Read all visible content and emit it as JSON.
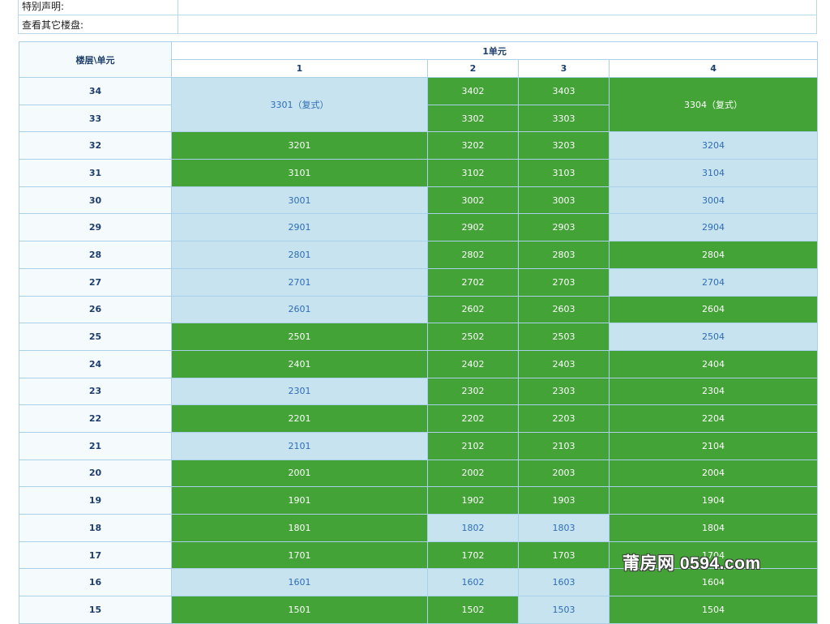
{
  "info": {
    "special_label": "特别声明:",
    "special_value": "",
    "other_label": "查看其它楼盘:",
    "other_value": ""
  },
  "table": {
    "corner_label": "楼层\\单元",
    "building_label": "1单元",
    "columns": [
      "1",
      "2",
      "3",
      "4"
    ],
    "colors": {
      "sold": "#43a336",
      "available": "#c6e3ef",
      "available_text": "#2f6db5"
    },
    "rows": [
      {
        "floor": "34",
        "cells": [
          {
            "label": "3301（复式）",
            "status": "available",
            "rowspan": 2
          },
          {
            "label": "3402",
            "status": "sold"
          },
          {
            "label": "3403",
            "status": "sold"
          },
          {
            "label": "3304（复式）",
            "status": "sold",
            "rowspan": 2
          }
        ]
      },
      {
        "floor": "33",
        "cells": [
          null,
          {
            "label": "3302",
            "status": "sold"
          },
          {
            "label": "3303",
            "status": "sold"
          },
          null
        ]
      },
      {
        "floor": "32",
        "cells": [
          {
            "label": "3201",
            "status": "sold"
          },
          {
            "label": "3202",
            "status": "sold"
          },
          {
            "label": "3203",
            "status": "sold"
          },
          {
            "label": "3204",
            "status": "available"
          }
        ]
      },
      {
        "floor": "31",
        "cells": [
          {
            "label": "3101",
            "status": "sold"
          },
          {
            "label": "3102",
            "status": "sold"
          },
          {
            "label": "3103",
            "status": "sold"
          },
          {
            "label": "3104",
            "status": "available"
          }
        ]
      },
      {
        "floor": "30",
        "cells": [
          {
            "label": "3001",
            "status": "available"
          },
          {
            "label": "3002",
            "status": "sold"
          },
          {
            "label": "3003",
            "status": "sold"
          },
          {
            "label": "3004",
            "status": "available"
          }
        ]
      },
      {
        "floor": "29",
        "cells": [
          {
            "label": "2901",
            "status": "available"
          },
          {
            "label": "2902",
            "status": "sold"
          },
          {
            "label": "2903",
            "status": "sold"
          },
          {
            "label": "2904",
            "status": "available"
          }
        ]
      },
      {
        "floor": "28",
        "cells": [
          {
            "label": "2801",
            "status": "available"
          },
          {
            "label": "2802",
            "status": "sold"
          },
          {
            "label": "2803",
            "status": "sold"
          },
          {
            "label": "2804",
            "status": "sold"
          }
        ]
      },
      {
        "floor": "27",
        "cells": [
          {
            "label": "2701",
            "status": "available"
          },
          {
            "label": "2702",
            "status": "sold"
          },
          {
            "label": "2703",
            "status": "sold"
          },
          {
            "label": "2704",
            "status": "available"
          }
        ]
      },
      {
        "floor": "26",
        "cells": [
          {
            "label": "2601",
            "status": "available"
          },
          {
            "label": "2602",
            "status": "sold"
          },
          {
            "label": "2603",
            "status": "sold"
          },
          {
            "label": "2604",
            "status": "sold"
          }
        ]
      },
      {
        "floor": "25",
        "cells": [
          {
            "label": "2501",
            "status": "sold"
          },
          {
            "label": "2502",
            "status": "sold"
          },
          {
            "label": "2503",
            "status": "sold"
          },
          {
            "label": "2504",
            "status": "available"
          }
        ]
      },
      {
        "floor": "24",
        "cells": [
          {
            "label": "2401",
            "status": "sold"
          },
          {
            "label": "2402",
            "status": "sold"
          },
          {
            "label": "2403",
            "status": "sold"
          },
          {
            "label": "2404",
            "status": "sold"
          }
        ]
      },
      {
        "floor": "23",
        "cells": [
          {
            "label": "2301",
            "status": "available"
          },
          {
            "label": "2302",
            "status": "sold"
          },
          {
            "label": "2303",
            "status": "sold"
          },
          {
            "label": "2304",
            "status": "sold"
          }
        ]
      },
      {
        "floor": "22",
        "cells": [
          {
            "label": "2201",
            "status": "sold"
          },
          {
            "label": "2202",
            "status": "sold"
          },
          {
            "label": "2203",
            "status": "sold"
          },
          {
            "label": "2204",
            "status": "sold"
          }
        ]
      },
      {
        "floor": "21",
        "cells": [
          {
            "label": "2101",
            "status": "available"
          },
          {
            "label": "2102",
            "status": "sold"
          },
          {
            "label": "2103",
            "status": "sold"
          },
          {
            "label": "2104",
            "status": "sold"
          }
        ]
      },
      {
        "floor": "20",
        "cells": [
          {
            "label": "2001",
            "status": "sold"
          },
          {
            "label": "2002",
            "status": "sold"
          },
          {
            "label": "2003",
            "status": "sold"
          },
          {
            "label": "2004",
            "status": "sold"
          }
        ]
      },
      {
        "floor": "19",
        "cells": [
          {
            "label": "1901",
            "status": "sold"
          },
          {
            "label": "1902",
            "status": "sold"
          },
          {
            "label": "1903",
            "status": "sold"
          },
          {
            "label": "1904",
            "status": "sold"
          }
        ]
      },
      {
        "floor": "18",
        "cells": [
          {
            "label": "1801",
            "status": "sold"
          },
          {
            "label": "1802",
            "status": "available"
          },
          {
            "label": "1803",
            "status": "available"
          },
          {
            "label": "1804",
            "status": "sold"
          }
        ]
      },
      {
        "floor": "17",
        "cells": [
          {
            "label": "1701",
            "status": "sold"
          },
          {
            "label": "1702",
            "status": "sold"
          },
          {
            "label": "1703",
            "status": "sold"
          },
          {
            "label": "1704",
            "status": "sold"
          }
        ]
      },
      {
        "floor": "16",
        "cells": [
          {
            "label": "1601",
            "status": "available"
          },
          {
            "label": "1602",
            "status": "available"
          },
          {
            "label": "1603",
            "status": "available"
          },
          {
            "label": "1604",
            "status": "sold"
          }
        ]
      },
      {
        "floor": "15",
        "cells": [
          {
            "label": "1501",
            "status": "sold"
          },
          {
            "label": "1502",
            "status": "sold"
          },
          {
            "label": "1503",
            "status": "available"
          },
          {
            "label": "1504",
            "status": "sold"
          }
        ]
      }
    ]
  },
  "watermark": "莆房网 0594.com"
}
